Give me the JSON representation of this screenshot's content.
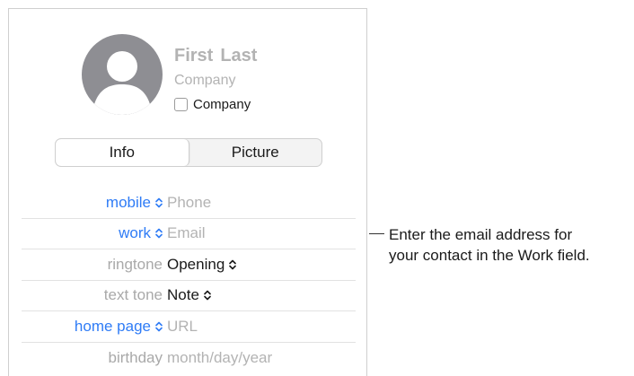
{
  "card": {
    "first_name": "First",
    "last_name": "Last",
    "company_placeholder": "Company",
    "company_checkbox_label": "Company",
    "company_checked": false
  },
  "tabs": {
    "selected": "Info",
    "items": [
      "Info",
      "Picture"
    ]
  },
  "fields": [
    {
      "label": "mobile",
      "value": "Phone",
      "label_style": "blue",
      "placeholder": true
    },
    {
      "label": "work",
      "value": "Email",
      "label_style": "blue",
      "placeholder": true
    },
    {
      "label": "ringtone",
      "value": "Opening",
      "label_style": "gray",
      "placeholder": false
    },
    {
      "label": "text tone",
      "value": "Note",
      "label_style": "gray",
      "placeholder": false
    },
    {
      "label": "home page",
      "value": "URL",
      "label_style": "blue",
      "placeholder": true
    },
    {
      "label": "birthday",
      "value": "month/day/year",
      "label_style": "gray",
      "placeholder": true
    }
  ],
  "callout": {
    "line1": "Enter the email address for",
    "line2": "your contact in the Work field."
  },
  "colors": {
    "accent": "#2f7cf6",
    "placeholder": "#b3b3b3",
    "avatar": "#8e8e93"
  }
}
